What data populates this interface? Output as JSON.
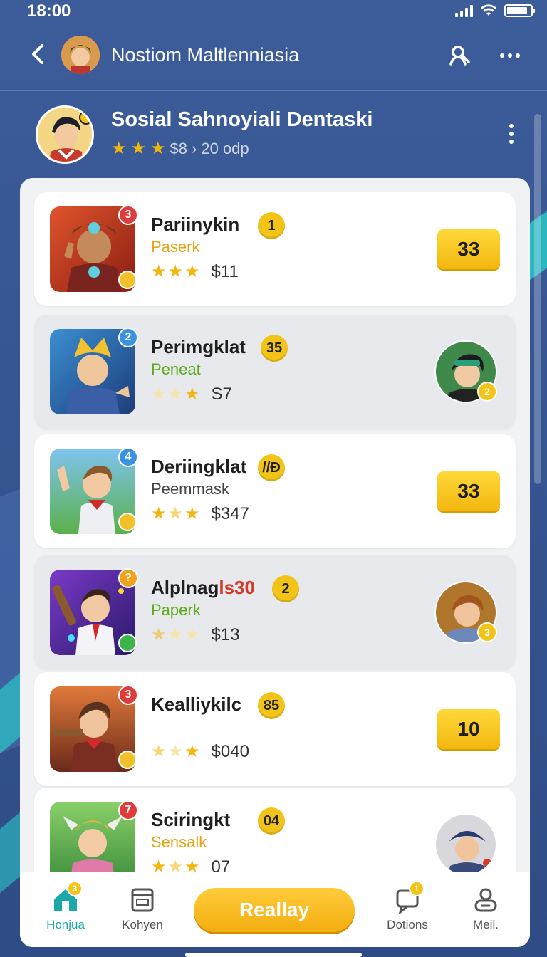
{
  "status_bar": {
    "time": "18:00"
  },
  "header": {
    "title": "Nostiom Maltlenniasia",
    "back_icon": "chevron-left-icon",
    "search_icon": "user-search-icon",
    "more_icon": "more-horizontal-icon"
  },
  "profile": {
    "name": "Sosial Sahnoyiali Dentaski",
    "stars": 3,
    "price": "$8",
    "separator": "›",
    "points": "20 odp"
  },
  "items": [
    {
      "name": "Pariinykin",
      "rank": "1",
      "subtitle": "Paserk",
      "subtitle_color": "#e8a312",
      "price": "$11",
      "rating": 3,
      "badge": "3",
      "badge_color": "#e03b3b",
      "right_type": "score",
      "score": "33",
      "alt": false
    },
    {
      "name": "Perimgklat",
      "rank": "35",
      "subtitle": "Peneat",
      "subtitle_color": "#5aab1e",
      "price": "S7",
      "rating": 1,
      "badge": "2",
      "badge_color": "#3a93e2",
      "right_type": "avatar",
      "avatar_badge": "2",
      "alt": true
    },
    {
      "name": "Deriingklat",
      "rank": "//Đ",
      "subtitle": "Peemmask",
      "subtitle_color": "#444444",
      "price": "$347",
      "rating": 2,
      "badge": "4",
      "badge_color": "#3a93e2",
      "right_type": "score",
      "score": "33",
      "alt": false
    },
    {
      "name": "Alplnagls30",
      "rank": "2",
      "subtitle": "Paperk",
      "subtitle_color": "#5aab1e",
      "price": "$13",
      "rating": 1,
      "badge": "?",
      "badge_color": "#f3a11a",
      "right_type": "avatar",
      "avatar_badge": "3",
      "alt": true
    },
    {
      "name": "Kealliykilc",
      "rank": "85",
      "subtitle": "",
      "subtitle_color": "#444444",
      "price": "$040",
      "rating": 1,
      "badge": "3",
      "badge_color": "#e03b3b",
      "right_type": "score",
      "score": "10",
      "alt": false
    },
    {
      "name": "Sciringkt",
      "rank": "04",
      "subtitle": "Sensalk",
      "subtitle_color": "#e8a312",
      "price": "07",
      "rating": 2,
      "badge": "7",
      "badge_color": "#e03b3b",
      "right_type": "avatar",
      "avatar_badge": "",
      "alt": false
    }
  ],
  "bottom_nav": {
    "home": {
      "label": "Honjua",
      "badge": "3",
      "icon": "home-icon"
    },
    "konyen": {
      "label": "Kohyen",
      "icon": "calendar-icon"
    },
    "cta": "Reallay",
    "dotions": {
      "label": "Dotions",
      "badge": "1",
      "icon": "chat-icon"
    },
    "meil": {
      "label": "Meil.",
      "icon": "profile-icon"
    }
  },
  "colors": {
    "accent": "#f3c418",
    "teal": "#1aa8a8",
    "background": "#365592"
  }
}
